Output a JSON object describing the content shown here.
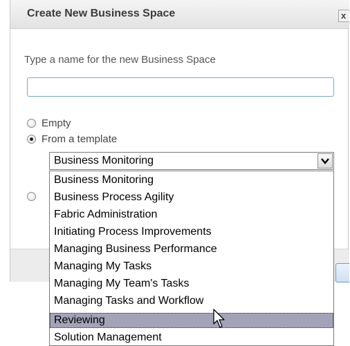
{
  "dialog": {
    "title": "Create New Business Space",
    "close_glyph": "x",
    "prompt": "Type a name for the new Business Space",
    "name_value": "",
    "radio_options": [
      {
        "label": "Empty",
        "checked": false
      },
      {
        "label": "From a template",
        "checked": true
      },
      {
        "label": "",
        "checked": false
      }
    ]
  },
  "template_select": {
    "selected": "Business Monitoring",
    "arrow_icon": "chevron-down-icon",
    "highlighted_index": 8,
    "options": [
      "Business Monitoring",
      "Business Process Agility",
      "Fabric Administration",
      "Initiating Process Improvements",
      "Managing Business Performance",
      "Managing My Tasks",
      "Managing My Team's Tasks",
      "Managing Tasks and Workflow",
      "Reviewing",
      "Solution Management"
    ]
  },
  "colors": {
    "highlight": "#a3a3b8",
    "input_border": "#7aa7c6"
  },
  "cursor_icon": "mouse-pointer-icon"
}
